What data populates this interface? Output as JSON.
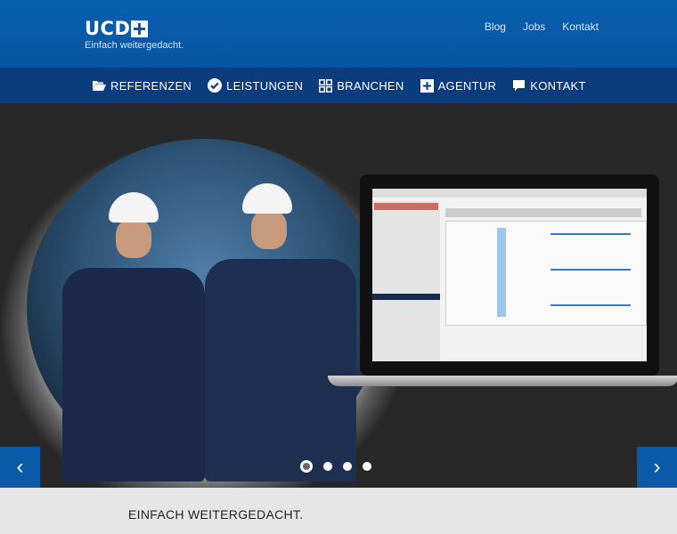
{
  "header": {
    "logo_text": "UCD",
    "tagline": "Einfach weitergedacht.",
    "links": [
      "Blog",
      "Jobs",
      "Kontakt"
    ]
  },
  "nav": {
    "items": [
      {
        "label": "REFERENZEN",
        "icon": "folder-open-icon"
      },
      {
        "label": "LEISTUNGEN",
        "icon": "check-circle-icon"
      },
      {
        "label": "BRANCHEN",
        "icon": "grid-icon"
      },
      {
        "label": "AGENTUR",
        "icon": "plus-square-icon"
      },
      {
        "label": "KONTAKT",
        "icon": "speech-bubble-icon"
      }
    ]
  },
  "hero": {
    "prev_glyph": "‹",
    "next_glyph": "›",
    "slide_count": 4,
    "active_slide": 1
  },
  "band": {
    "title": "EINFACH WEITERGEDACHT."
  },
  "colors": {
    "header_blue": "#0a5aa8",
    "nav_blue": "#0b3c7e",
    "band_gray": "#e6e6e6"
  }
}
